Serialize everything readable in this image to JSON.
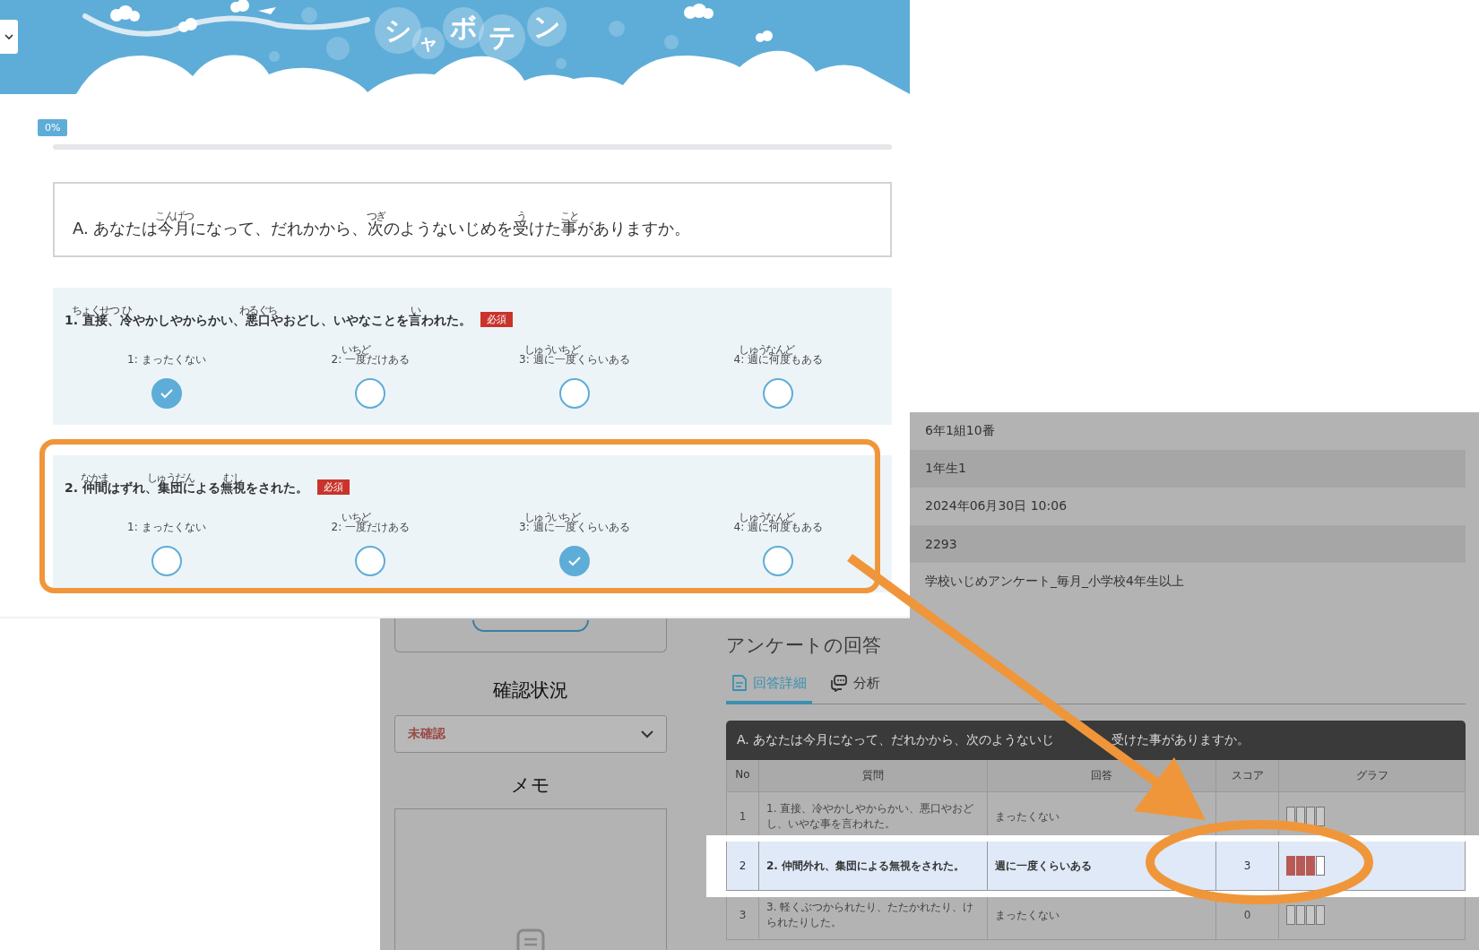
{
  "header": {
    "logo": [
      "シ",
      "ャ",
      "ボ",
      "テ",
      "ン"
    ]
  },
  "progress": {
    "label": "0%"
  },
  "section": {
    "segments": [
      "A. あなたは",
      {
        "text": "今月",
        "ruby": "こんげつ"
      },
      "になって、だれかから、",
      {
        "text": "次",
        "ruby": "つぎ"
      },
      "のようないじめを",
      {
        "text": "受",
        "ruby": "う"
      },
      "けた",
      {
        "text": "事",
        "ruby": "こと"
      },
      "がありますか。"
    ]
  },
  "questions": [
    {
      "segments": [
        "1. ",
        {
          "text": "直接",
          "ruby": "ちょくせつ"
        },
        "、",
        {
          "text": "冷",
          "ruby": "ひ"
        },
        "やかしやからかい、",
        {
          "text": "悪口",
          "ruby": "わるぐち"
        },
        "やおどし、いやなことを",
        {
          "text": "言",
          "ruby": "い"
        },
        "われた。"
      ],
      "required": "必須",
      "options": [
        {
          "number": "1:",
          "segments": [
            "まったくない"
          ],
          "selected": true
        },
        {
          "number": "2:",
          "segments": [
            {
              "text": "一度",
              "ruby": "いちど"
            },
            "だけある"
          ],
          "selected": false
        },
        {
          "number": "3:",
          "segments": [
            {
              "text": "週",
              "ruby": "しゅう"
            },
            "に",
            {
              "text": "一度",
              "ruby": "いちど"
            },
            "くらいある"
          ],
          "selected": false
        },
        {
          "number": "4:",
          "segments": [
            {
              "text": "週",
              "ruby": "しゅう"
            },
            "に",
            {
              "text": "何度",
              "ruby": "なんど"
            },
            "もある"
          ],
          "selected": false
        }
      ]
    },
    {
      "segments": [
        "2. ",
        {
          "text": "仲間",
          "ruby": "なかま"
        },
        "はずれ、",
        {
          "text": "集団",
          "ruby": "しゅうだん"
        },
        "による",
        {
          "text": "無視",
          "ruby": "むし"
        },
        "をされた。"
      ],
      "required": "必須",
      "options": [
        {
          "number": "1:",
          "segments": [
            "まったくない"
          ],
          "selected": false
        },
        {
          "number": "2:",
          "segments": [
            {
              "text": "一度",
              "ruby": "いちど"
            },
            "だけある"
          ],
          "selected": false
        },
        {
          "number": "3:",
          "segments": [
            {
              "text": "週",
              "ruby": "しゅう"
            },
            "に",
            {
              "text": "一度",
              "ruby": "いちど"
            },
            "くらいある"
          ],
          "selected": true
        },
        {
          "number": "4:",
          "segments": [
            {
              "text": "週",
              "ruby": "しゅう"
            },
            "に",
            {
              "text": "何度",
              "ruby": "なんど"
            },
            "もある"
          ],
          "selected": false
        }
      ]
    }
  ],
  "admin": {
    "status_heading": "確認状況",
    "status_select": {
      "value": "未確認"
    },
    "memo_heading": "メモ",
    "info_rows": [
      "6年1組10番",
      "1年生1",
      "2024年06月30日 10:06",
      "2293",
      "学校いじめアンケート_毎月_小学校4年生以上"
    ],
    "answers_title": "アンケートの回答",
    "tabs": [
      {
        "label": "回答詳細",
        "kind": "document",
        "selected": true
      },
      {
        "label": "分析",
        "kind": "chat",
        "selected": false
      }
    ],
    "table": {
      "title_parts": [
        "A. あなたは今月になって、だれかから、次のようないじ",
        "受けた事がありますか。"
      ],
      "columns": [
        "No",
        "質問",
        "回答",
        "スコア",
        "グラフ"
      ],
      "rows": [
        {
          "no": "1",
          "question": "1. 直接、冷やかしやからかい、悪口やおどし、いやな事を言われた。",
          "answer": "まったくない",
          "highlighted": false,
          "bars": [
            {
              "filled": false
            },
            {
              "filled": false
            },
            {
              "filled": false
            },
            {
              "filled": false
            }
          ]
        },
        {
          "no": "2",
          "question": "2. 仲間外れ、集団による無視をされた。",
          "answer": "週に一度くらいある",
          "score": "3",
          "highlighted": true,
          "bars": [
            {
              "filled": true
            },
            {
              "filled": true
            },
            {
              "filled": true
            },
            {
              "filled": false
            }
          ]
        },
        {
          "no": "3",
          "question": "3. 軽くぶつかられたり、たたかれたり、けられたりした。",
          "answer": "まったくない",
          "score": "0",
          "highlighted": false,
          "bars": [
            {
              "filled": false
            },
            {
              "filled": false
            },
            {
              "filled": false
            },
            {
              "filled": false
            }
          ]
        }
      ]
    }
  }
}
